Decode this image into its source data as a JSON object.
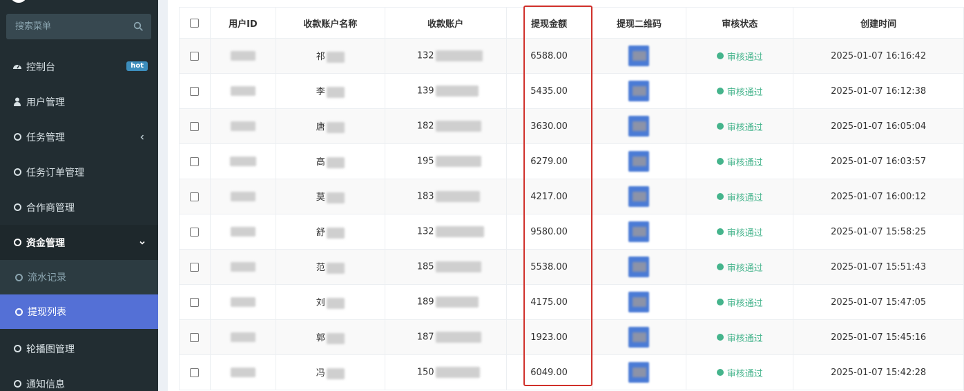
{
  "sidebar": {
    "search_placeholder": "搜索菜单",
    "items": [
      {
        "label": "控制台",
        "badge": "hot"
      },
      {
        "label": "用户管理"
      },
      {
        "label": "任务管理"
      },
      {
        "label": "任务订单管理"
      },
      {
        "label": "合作商管理"
      },
      {
        "label": "资金管理"
      },
      {
        "label": "流水记录"
      },
      {
        "label": "提现列表"
      },
      {
        "label": "轮播图管理"
      },
      {
        "label": "通知信息"
      }
    ]
  },
  "table": {
    "columns": [
      "用户ID",
      "收款账户名称",
      "收款账户",
      "提现金额",
      "提现二维码",
      "审核状态",
      "创建时间"
    ],
    "rows": [
      {
        "name": "祁",
        "account": "132",
        "amount": "6588.00",
        "status": "审核通过",
        "created": "2025-01-07 16:16:42"
      },
      {
        "name": "李",
        "account": "139",
        "amount": "5435.00",
        "status": "审核通过",
        "created": "2025-01-07 16:12:38"
      },
      {
        "name": "唐",
        "account": "182",
        "amount": "3630.00",
        "status": "审核通过",
        "created": "2025-01-07 16:05:04"
      },
      {
        "name": "高",
        "account": "195",
        "amount": "6279.00",
        "status": "审核通过",
        "created": "2025-01-07 16:03:57"
      },
      {
        "name": "莫",
        "account": "183",
        "amount": "4217.00",
        "status": "审核通过",
        "created": "2025-01-07 16:00:12"
      },
      {
        "name": "舒",
        "account": "132",
        "amount": "9580.00",
        "status": "审核通过",
        "created": "2025-01-07 15:58:25"
      },
      {
        "name": "范",
        "account": "185",
        "amount": "5538.00",
        "status": "审核通过",
        "created": "2025-01-07 15:51:43"
      },
      {
        "name": "刘",
        "account": "189",
        "amount": "4175.00",
        "status": "审核通过",
        "created": "2025-01-07 15:47:05"
      },
      {
        "name": "郭",
        "account": "187",
        "amount": "1923.00",
        "status": "审核通过",
        "created": "2025-01-07 15:45:16"
      },
      {
        "name": "冯",
        "account": "150",
        "amount": "6049.00",
        "status": "审核通过",
        "created": "2025-01-07 15:42:28"
      }
    ]
  },
  "colors": {
    "sidebar_bg": "#222d32",
    "active_item": "#5470d6",
    "status_green": "#45b48c",
    "highlight_red": "#d0302a",
    "hot_badge": "#3c8dbc"
  }
}
